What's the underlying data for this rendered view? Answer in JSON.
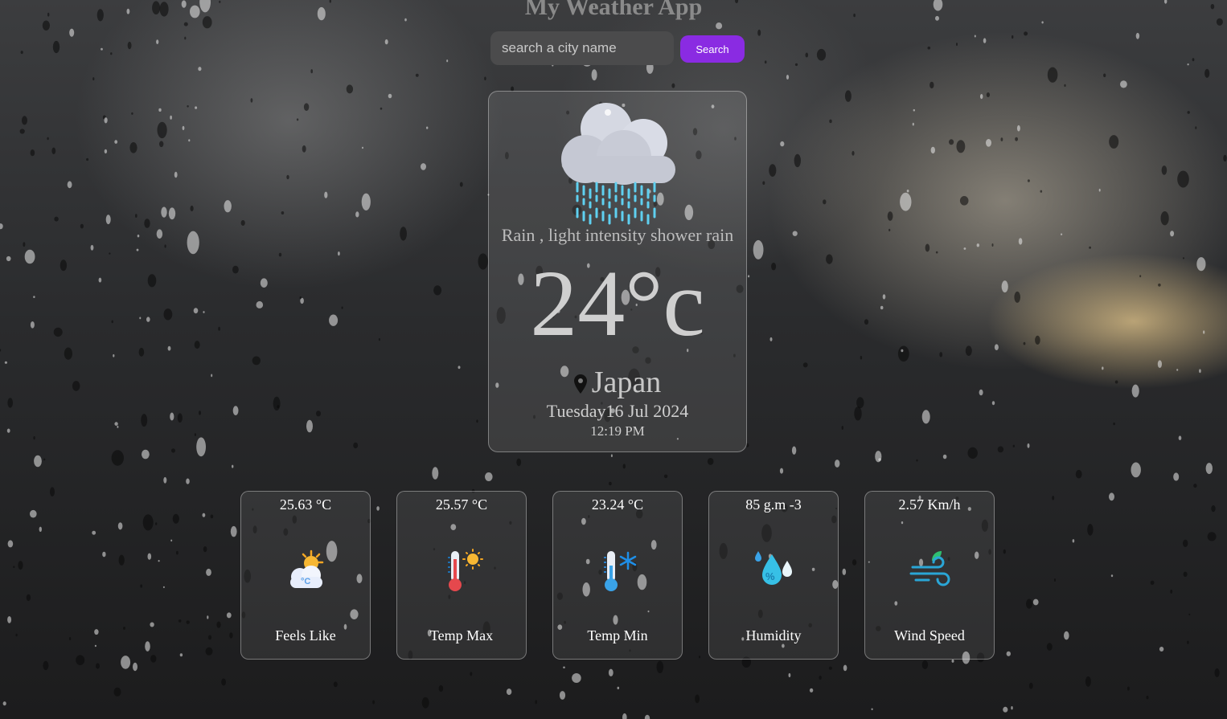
{
  "app": {
    "title": "My Weather App"
  },
  "search": {
    "placeholder": "search a city name",
    "value": "",
    "button_label": "Search"
  },
  "current": {
    "icon": "rain-cloud-icon",
    "description": "Rain , light intensity shower rain",
    "temperature": "24°c",
    "location": "Japan",
    "date": "Tuesday16 Jul 2024",
    "time": "12:19 PM"
  },
  "stats": [
    {
      "value": "25.63 °C",
      "label": "Feels Like",
      "icon": "sun-cloud-icon"
    },
    {
      "value": "25.57 °C",
      "label": "Temp Max",
      "icon": "thermometer-hot-icon"
    },
    {
      "value": "23.24 °C",
      "label": "Temp Min",
      "icon": "thermometer-cold-icon"
    },
    {
      "value": "85 g.m -3",
      "label": "Humidity",
      "icon": "humidity-drops-icon"
    },
    {
      "value": "2.57 Km/h",
      "label": "Wind Speed",
      "icon": "wind-icon"
    }
  ],
  "colors": {
    "accent": "#8a2be2",
    "rain": "#5fd0f0"
  }
}
